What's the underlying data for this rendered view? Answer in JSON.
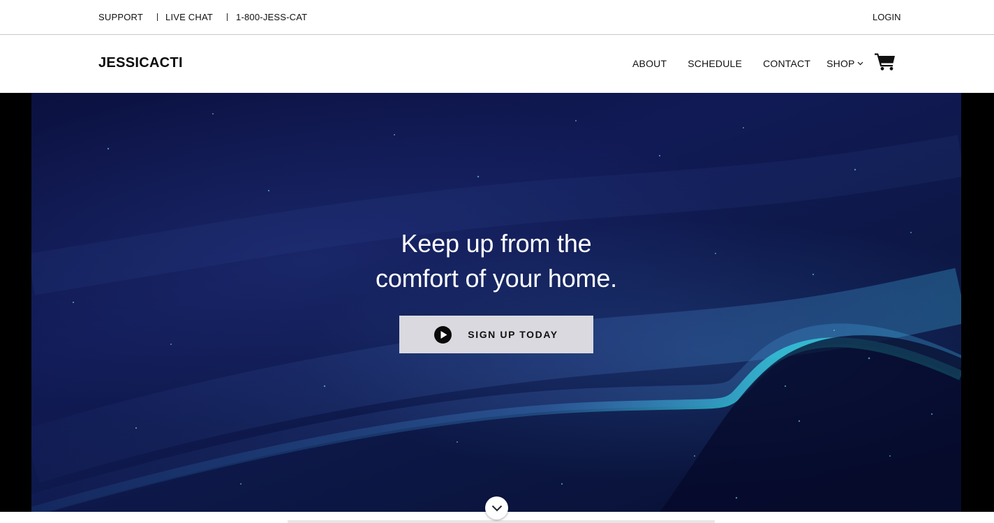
{
  "utility_bar": {
    "links": [
      "SUPPORT",
      "LIVE CHAT",
      "1-800-JESS-CAT"
    ],
    "login": "LOGIN"
  },
  "header": {
    "brand": "JESSICACTI",
    "nav": [
      "ABOUT",
      "SCHEDULE",
      "CONTACT",
      "SHOP"
    ],
    "cart_icon": "shopping-cart-icon"
  },
  "hero": {
    "headline_line1": "Keep up from the",
    "headline_line2": "comfort of your home.",
    "cta_label": "SIGN UP TODAY",
    "cta_icon": "play-circle-icon",
    "scroll_icon": "chevron-down-icon"
  },
  "colors": {
    "hero_background": "#0d1848",
    "accent_teal": "#2fd3d8",
    "cta_background": "#d9d9df"
  }
}
